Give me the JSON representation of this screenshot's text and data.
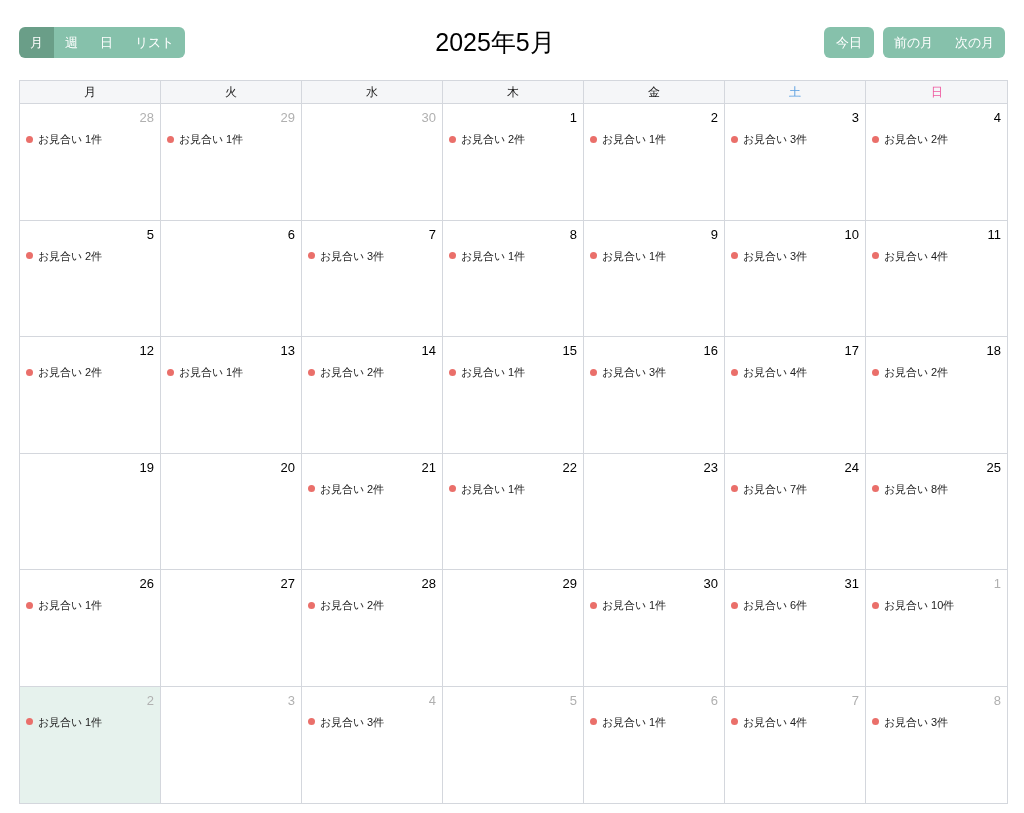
{
  "view_tabs": [
    {
      "label": "月",
      "selected": true
    },
    {
      "label": "週",
      "selected": false
    },
    {
      "label": "日",
      "selected": false
    },
    {
      "label": "リスト",
      "selected": false
    }
  ],
  "title": "2025年5月",
  "today_button": "今日",
  "nav_buttons": [
    "前の月",
    "次の月"
  ],
  "weekdays": [
    {
      "label": "月",
      "kind": "weekday"
    },
    {
      "label": "火",
      "kind": "weekday"
    },
    {
      "label": "水",
      "kind": "weekday"
    },
    {
      "label": "木",
      "kind": "weekday"
    },
    {
      "label": "金",
      "kind": "weekday"
    },
    {
      "label": "土",
      "kind": "saturday"
    },
    {
      "label": "日",
      "kind": "sunday"
    }
  ],
  "weeks": [
    [
      {
        "day": "28",
        "other_month": true,
        "today": false,
        "events": [
          "お見合い 1件"
        ]
      },
      {
        "day": "29",
        "other_month": true,
        "today": false,
        "events": [
          "お見合い 1件"
        ]
      },
      {
        "day": "30",
        "other_month": true,
        "today": false
      },
      {
        "day": "1",
        "other_month": false,
        "today": false,
        "events": [
          "お見合い 2件"
        ]
      },
      {
        "day": "2",
        "other_month": false,
        "today": false,
        "events": [
          "お見合い 1件"
        ]
      },
      {
        "day": "3",
        "other_month": false,
        "today": false,
        "events": [
          "お見合い 3件"
        ]
      },
      {
        "day": "4",
        "other_month": false,
        "today": false,
        "events": [
          "お見合い 2件"
        ]
      }
    ],
    [
      {
        "day": "5",
        "other_month": false,
        "today": false,
        "events": [
          "お見合い 2件"
        ]
      },
      {
        "day": "6",
        "other_month": false,
        "today": false
      },
      {
        "day": "7",
        "other_month": false,
        "today": false,
        "events": [
          "お見合い 3件"
        ]
      },
      {
        "day": "8",
        "other_month": false,
        "today": false,
        "events": [
          "お見合い 1件"
        ]
      },
      {
        "day": "9",
        "other_month": false,
        "today": false,
        "events": [
          "お見合い 1件"
        ]
      },
      {
        "day": "10",
        "other_month": false,
        "today": false,
        "events": [
          "お見合い 3件"
        ]
      },
      {
        "day": "11",
        "other_month": false,
        "today": false,
        "events": [
          "お見合い 4件"
        ]
      }
    ],
    [
      {
        "day": "12",
        "other_month": false,
        "today": false,
        "events": [
          "お見合い 2件"
        ]
      },
      {
        "day": "13",
        "other_month": false,
        "today": false,
        "events": [
          "お見合い 1件"
        ]
      },
      {
        "day": "14",
        "other_month": false,
        "today": false,
        "events": [
          "お見合い 2件"
        ]
      },
      {
        "day": "15",
        "other_month": false,
        "today": false,
        "events": [
          "お見合い 1件"
        ]
      },
      {
        "day": "16",
        "other_month": false,
        "today": false,
        "events": [
          "お見合い 3件"
        ]
      },
      {
        "day": "17",
        "other_month": false,
        "today": false,
        "events": [
          "お見合い 4件"
        ]
      },
      {
        "day": "18",
        "other_month": false,
        "today": false,
        "events": [
          "お見合い 2件"
        ]
      }
    ],
    [
      {
        "day": "19",
        "other_month": false,
        "today": false
      },
      {
        "day": "20",
        "other_month": false,
        "today": false
      },
      {
        "day": "21",
        "other_month": false,
        "today": false,
        "events": [
          "お見合い 2件"
        ]
      },
      {
        "day": "22",
        "other_month": false,
        "today": false,
        "events": [
          "お見合い 1件"
        ]
      },
      {
        "day": "23",
        "other_month": false,
        "today": false
      },
      {
        "day": "24",
        "other_month": false,
        "today": false,
        "events": [
          "お見合い 7件"
        ]
      },
      {
        "day": "25",
        "other_month": false,
        "today": false,
        "events": [
          "お見合い 8件"
        ]
      }
    ],
    [
      {
        "day": "26",
        "other_month": false,
        "today": false,
        "events": [
          "お見合い 1件"
        ]
      },
      {
        "day": "27",
        "other_month": false,
        "today": false
      },
      {
        "day": "28",
        "other_month": false,
        "today": false,
        "events": [
          "お見合い 2件"
        ]
      },
      {
        "day": "29",
        "other_month": false,
        "today": false
      },
      {
        "day": "30",
        "other_month": false,
        "today": false,
        "events": [
          "お見合い 1件"
        ]
      },
      {
        "day": "31",
        "other_month": false,
        "today": false,
        "events": [
          "お見合い 6件"
        ]
      },
      {
        "day": "1",
        "other_month": true,
        "today": false,
        "events": [
          "お見合い 10件"
        ]
      }
    ],
    [
      {
        "day": "2",
        "other_month": true,
        "today": true,
        "events": [
          "お見合い 1件"
        ]
      },
      {
        "day": "3",
        "other_month": true,
        "today": false
      },
      {
        "day": "4",
        "other_month": true,
        "today": false,
        "events": [
          "お見合い 3件"
        ]
      },
      {
        "day": "5",
        "other_month": true,
        "today": false
      },
      {
        "day": "6",
        "other_month": true,
        "today": false,
        "events": [
          "お見合い 1件"
        ]
      },
      {
        "day": "7",
        "other_month": true,
        "today": false,
        "events": [
          "お見合い 4件"
        ]
      },
      {
        "day": "8",
        "other_month": true,
        "today": false,
        "events": [
          "お見合い 3件"
        ]
      }
    ]
  ]
}
